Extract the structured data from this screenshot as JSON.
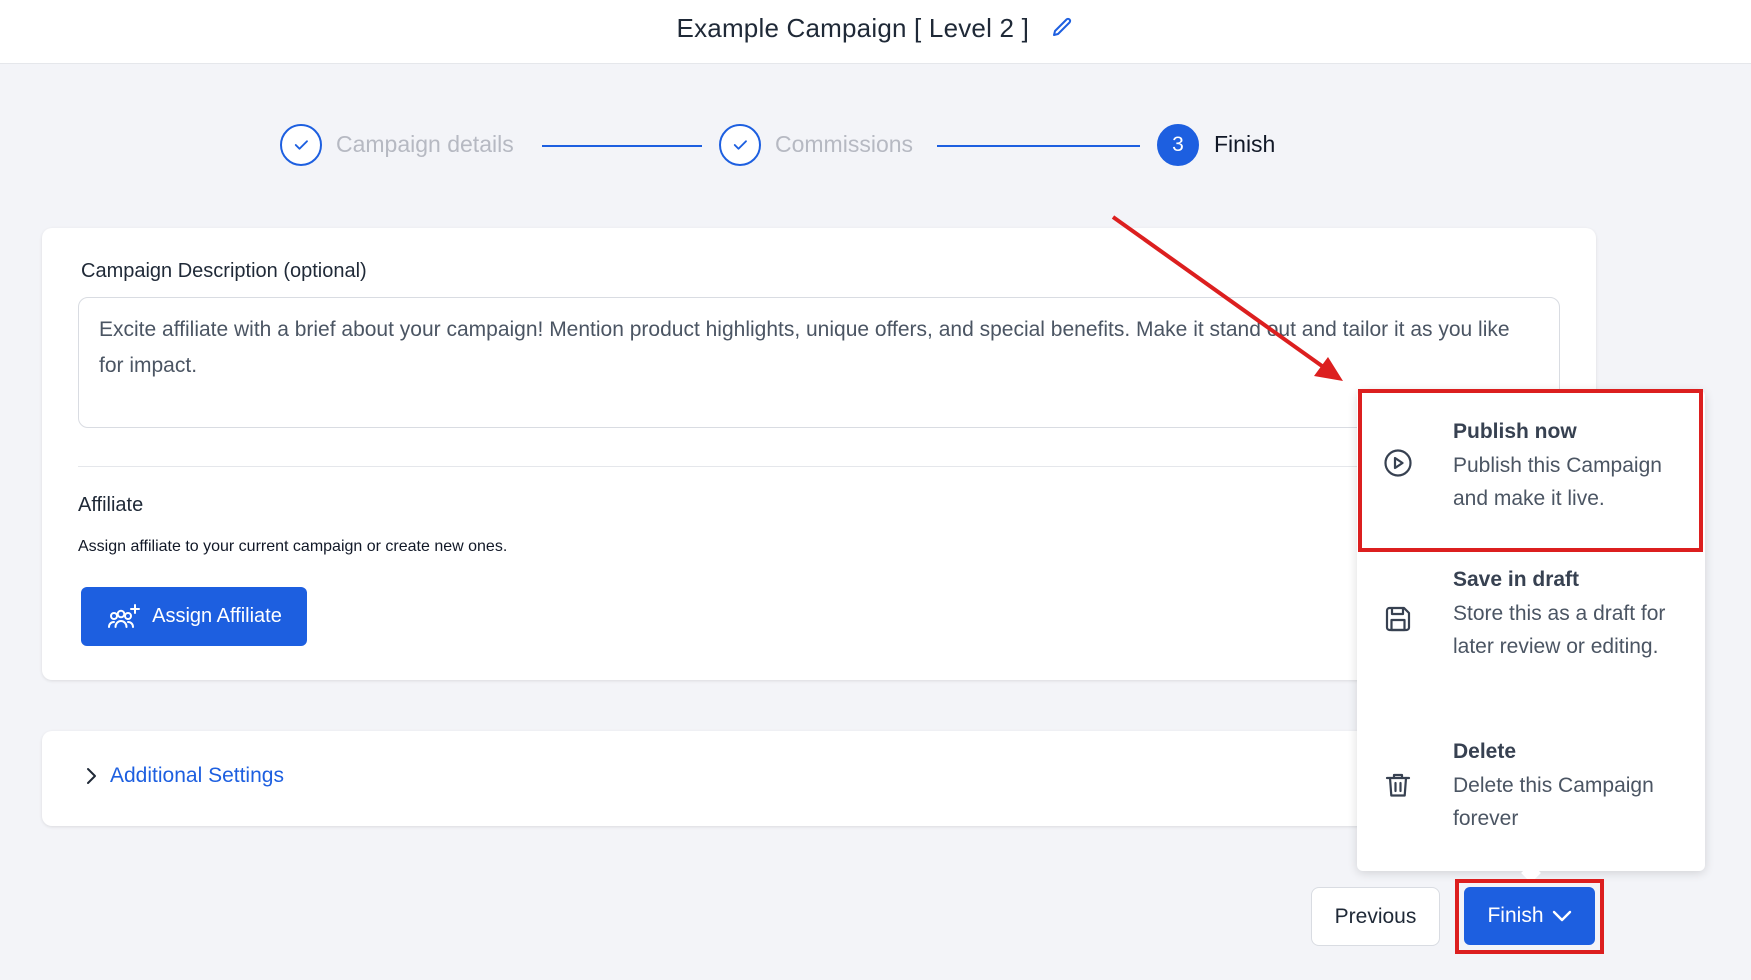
{
  "header": {
    "title": "Example Campaign [ Level 2 ]"
  },
  "stepper": {
    "steps": [
      {
        "label": "Campaign details",
        "state": "done"
      },
      {
        "label": "Commissions",
        "state": "done"
      },
      {
        "label": "Finish",
        "number": "3",
        "state": "active"
      }
    ]
  },
  "description": {
    "label": "Campaign Description (optional)",
    "placeholder": "Excite affiliate with a brief about your campaign! Mention product highlights, unique offers, and special benefits. Make it stand out and tailor it as you like for impact."
  },
  "affiliate": {
    "title": "Affiliate",
    "description": "Assign affiliate to your current campaign or create new ones.",
    "assign_label": "Assign Affiliate"
  },
  "additional_settings": {
    "label": "Additional Settings"
  },
  "finish_menu": {
    "items": [
      {
        "title": "Publish now",
        "description": "Publish this Campaign and make it live.",
        "icon": "play-circle-icon"
      },
      {
        "title": "Save in draft",
        "description": "Store this as a draft for later review or editing.",
        "icon": "save-icon"
      },
      {
        "title": "Delete",
        "description": "Delete this Campaign forever",
        "icon": "trash-icon"
      }
    ]
  },
  "footer": {
    "previous_label": "Previous",
    "finish_label": "Finish"
  },
  "colors": {
    "primary": "#1d5fe0",
    "highlight": "#dc1f1f",
    "background": "#f3f4f8"
  }
}
